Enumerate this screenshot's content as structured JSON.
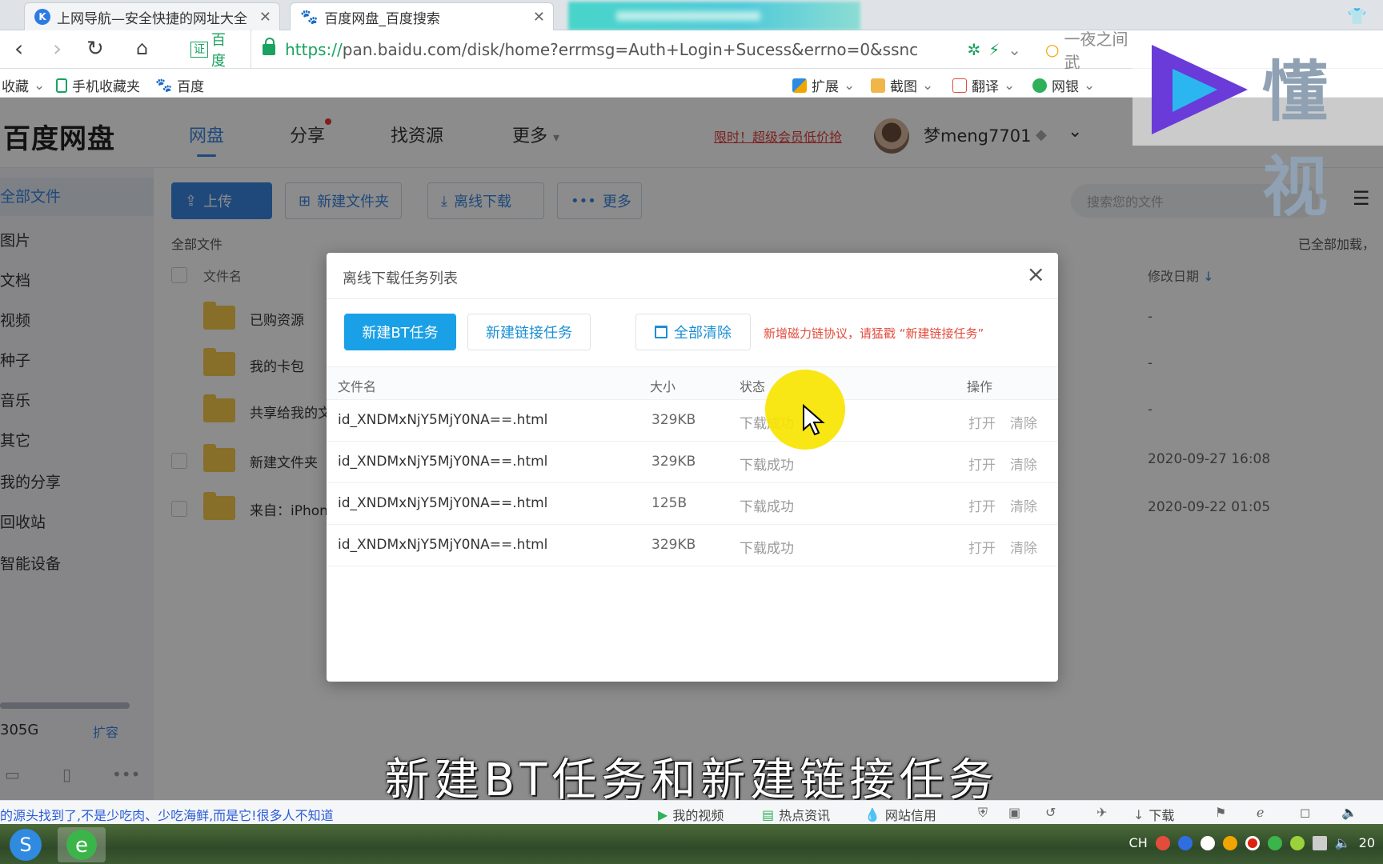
{
  "browser": {
    "tabs": [
      {
        "title": "上网导航—安全快捷的网址大全",
        "icon": "K"
      },
      {
        "title": "百度网盘_百度搜索",
        "icon": "paw"
      }
    ],
    "url_scheme": "https://",
    "url_rest": "pan.baidu.com/disk/home?errmsg=Auth+Login+Sucess&errno=0&ssnc",
    "cert_label": "百度",
    "cert_badge": "证",
    "search_hint": "一夜之间武",
    "bookmarks": {
      "left": [
        "收藏",
        "手机收藏夹",
        "百度"
      ],
      "right": [
        "扩展",
        "截图",
        "翻译",
        "网银"
      ]
    }
  },
  "app": {
    "logo": "百度网盘",
    "nav": [
      "网盘",
      "分享",
      "找资源",
      "更多"
    ],
    "promo": "限时！超级会员低价抢",
    "username": "梦meng7701",
    "sidebar": {
      "items": [
        "全部文件",
        "图片",
        "文档",
        "视频",
        "种子",
        "音乐",
        "其它",
        "我的分享",
        "回收站",
        "智能设备"
      ],
      "quota": "305G",
      "quota_fill": 1.0,
      "expand": "扩容"
    },
    "toolbar": {
      "upload": "上传",
      "new_folder": "新建文件夹",
      "offline_download": "离线下载",
      "more": "更多",
      "search_placeholder": "搜索您的文件"
    },
    "breadcrumb": "全部文件",
    "loaded_all": "已全部加载，",
    "list": {
      "col_name": "文件名",
      "col_date": "修改日期",
      "rows": [
        {
          "name": "已购资源",
          "date": "-"
        },
        {
          "name": "我的卡包",
          "date": "-"
        },
        {
          "name": "共享给我的文",
          "date": "-"
        },
        {
          "name": "新建文件夹",
          "date": "2020-09-27 16:08"
        },
        {
          "name": "来自：iPhon",
          "date": "2020-09-22 01:05"
        }
      ]
    }
  },
  "dialog": {
    "title": "离线下载任务列表",
    "btn_new_bt": "新建BT任务",
    "btn_new_link": "新建链接任务",
    "btn_clear_all": "全部清除",
    "notice": "新增磁力链协议，请猛戳 “新建链接任务”",
    "columns": {
      "name": "文件名",
      "size": "大小",
      "status": "状态",
      "actions": "操作"
    },
    "rows": [
      {
        "name": "id_XNDMxNjY5MjY0NA==.html",
        "size": "329KB",
        "status": "下载成功",
        "open": "打开",
        "clear": "清除"
      },
      {
        "name": "id_XNDMxNjY5MjY0NA==.html",
        "size": "329KB",
        "status": "下载成功",
        "open": "打开",
        "clear": "清除"
      },
      {
        "name": "id_XNDMxNjY5MjY0NA==.html",
        "size": "125B",
        "status": "下载成功",
        "open": "打开",
        "clear": "清除"
      },
      {
        "name": "id_XNDMxNjY5MjY0NA==.html",
        "size": "329KB",
        "status": "下载成功",
        "open": "打开",
        "clear": "清除"
      }
    ]
  },
  "subtitle": "新建BT任务和新建链接任务",
  "watermark": "懂视",
  "statusbar": {
    "ticker": "的源头找到了,不是少吃肉、少吃海鲜,而是它!很多人不知道",
    "items": [
      "我的视频",
      "热点资讯",
      "网站信用",
      "下载"
    ]
  },
  "taskbar": {
    "lang": "CH",
    "clock": "20"
  }
}
